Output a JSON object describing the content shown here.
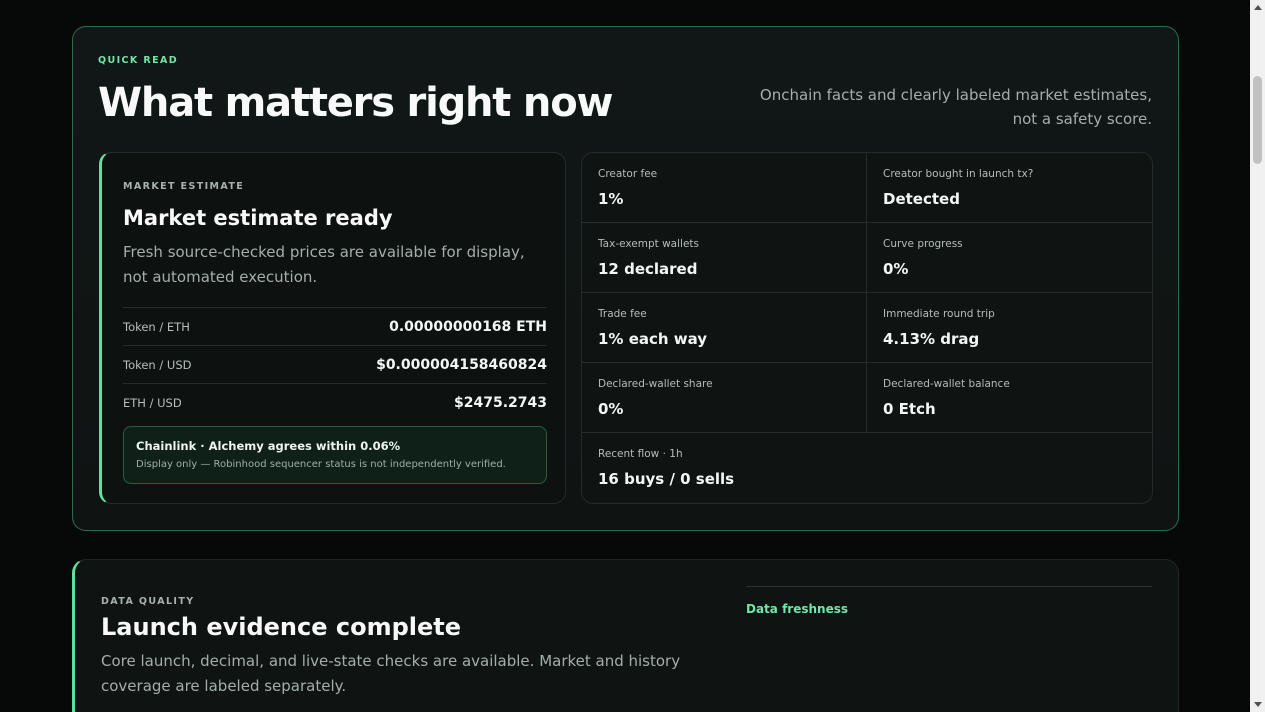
{
  "quick_read": {
    "eyebrow": "QUICK READ",
    "title": "What matters right now",
    "subtitle": "Onchain facts and clearly labeled market estimates, not a safety score."
  },
  "market_estimate": {
    "eyebrow": "MARKET ESTIMATE",
    "title": "Market estimate ready",
    "description": "Fresh source-checked prices are available for display, not automated execution.",
    "prices": [
      {
        "label": "Token / ETH",
        "value": "0.00000000168 ETH"
      },
      {
        "label": "Token / USD",
        "value": "$0.000004158460824"
      },
      {
        "label": "ETH / USD",
        "value": "$2475.2743"
      }
    ],
    "agreement": {
      "title": "Chainlink · Alchemy agrees within 0.06%",
      "note": "Display only — Robinhood sequencer status is not independently verified."
    }
  },
  "facts": [
    {
      "label": "Creator fee",
      "value": "1%"
    },
    {
      "label": "Creator bought in launch tx?",
      "value": "Detected"
    },
    {
      "label": "Tax-exempt wallets",
      "value": "12 declared"
    },
    {
      "label": "Curve progress",
      "value": "0%"
    },
    {
      "label": "Trade fee",
      "value": "1% each way"
    },
    {
      "label": "Immediate round trip",
      "value": "4.13% drag"
    },
    {
      "label": "Declared-wallet share",
      "value": "0%"
    },
    {
      "label": "Declared-wallet balance",
      "value": "0 Etch"
    },
    {
      "label": "Recent flow · 1h",
      "value": "16 buys / 0 sells"
    }
  ],
  "data_quality": {
    "eyebrow": "DATA QUALITY",
    "title": "Launch evidence complete",
    "description": "Core launch, decimal, and live-state checks are available. Market and history coverage are labeled separately.",
    "freshness_label": "Data freshness"
  },
  "colors": {
    "accent": "#6ee7a8",
    "background": "#070909",
    "card": "#0f1413"
  }
}
